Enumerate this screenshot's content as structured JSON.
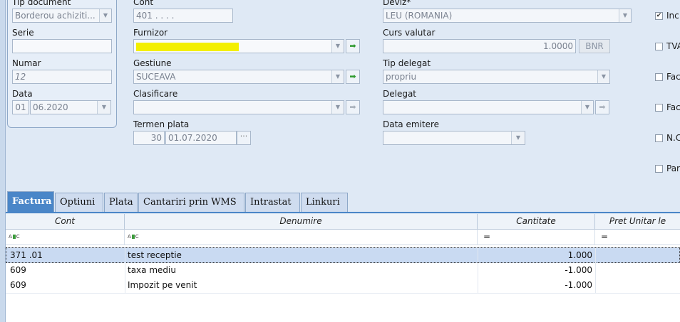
{
  "left_panel": {
    "tip_document": {
      "label": "Tip document",
      "value": "Borderou achiziti..."
    },
    "serie": {
      "label": "Serie",
      "value": ""
    },
    "numar": {
      "label": "Numar",
      "value": "12"
    },
    "data": {
      "label": "Data",
      "day": "01",
      "rest": "06.2020"
    }
  },
  "mid_panel": {
    "cont": {
      "label": "Cont",
      "value": "401 .  .  .  ."
    },
    "furnizor": {
      "label": "Furnizor",
      "value": ""
    },
    "gestiune": {
      "label": "Gestiune",
      "value": "SUCEAVA"
    },
    "clasificare": {
      "label": "Clasificare",
      "value": ""
    },
    "termen_plata": {
      "label": "Termen plata",
      "days": "30",
      "date": "01.07.2020",
      "ellipsis": "···"
    }
  },
  "right_panel": {
    "deviz": {
      "label": "Deviz*",
      "value": "LEU (ROMANIA)"
    },
    "curs_valutar": {
      "label": "Curs valutar",
      "value": "1.0000",
      "button": "BNR"
    },
    "tip_delegat": {
      "label": "Tip delegat",
      "value": "propriu"
    },
    "delegat": {
      "label": "Delegat",
      "value": ""
    },
    "data_emitere": {
      "label": "Data emitere",
      "value": ""
    }
  },
  "checkboxes": [
    {
      "label": "Inc",
      "checked": true
    },
    {
      "label": "TVA",
      "checked": false
    },
    {
      "label": "Fac",
      "checked": false
    },
    {
      "label": "Fac",
      "checked": false
    },
    {
      "label": "N.C",
      "checked": false
    },
    {
      "label": "Par",
      "checked": false
    }
  ],
  "tabs": [
    "Factura",
    "Optiuni",
    "Plata",
    "Cantariri prin WMS",
    "Intrastat",
    "Linkuri"
  ],
  "grid": {
    "columns": [
      "Cont",
      "Denumire",
      "Cantitate",
      "Pret Unitar le"
    ],
    "filter": {
      "abc_left": "A",
      "abc_right": "C",
      "eq": "="
    },
    "rows": [
      {
        "cont": "371 .01",
        "denumire": "test receptie",
        "cantitate": "1.000"
      },
      {
        "cont": "609",
        "denumire": "taxa mediu",
        "cantitate": "-1.000"
      },
      {
        "cont": "609",
        "denumire": "Impozit pe venit",
        "cantitate": "-1.000"
      }
    ]
  },
  "icons": {
    "go": "green-arrow-icon",
    "dropdown": "chevron-down-icon",
    "check": "checkmark-icon"
  },
  "colors": {
    "accent": "#4a86c8",
    "highlight": "#f3ef00",
    "background": "#dfe9f5"
  }
}
